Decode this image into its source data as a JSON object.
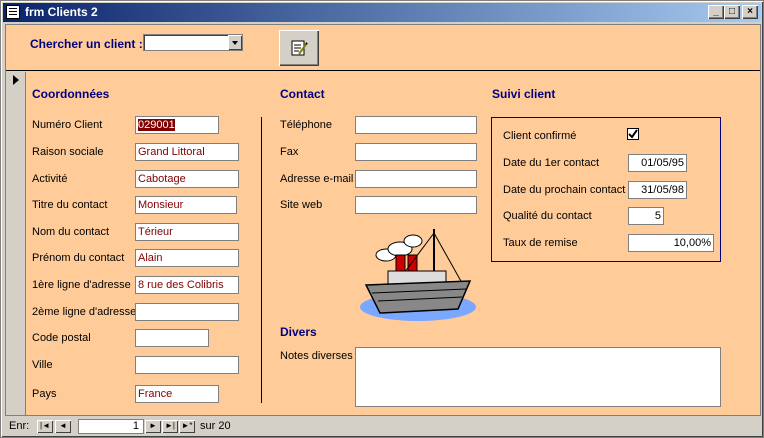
{
  "window": {
    "title": "frm Clients 2"
  },
  "titlebar_buttons": {
    "minimize": "_",
    "maximize": "□",
    "close": "×"
  },
  "header": {
    "search_label": "Chercher un client :",
    "search_value": "",
    "edit_icon": "notepad-pencil-icon"
  },
  "coordonnees": {
    "title": "Coordonnées",
    "fields": [
      {
        "label": "Numéro Client",
        "value": "029001"
      },
      {
        "label": "Raison sociale",
        "value": "Grand Littoral"
      },
      {
        "label": "Activité",
        "value": "Cabotage"
      },
      {
        "label": "Titre du contact",
        "value": "Monsieur"
      },
      {
        "label": "Nom du contact",
        "value": "Térieur"
      },
      {
        "label": "Prénom du contact",
        "value": "Alain"
      },
      {
        "label": "1ère ligne d'adresse",
        "value": "8 rue des Colibris"
      },
      {
        "label": "2ème ligne d'adresse",
        "value": ""
      },
      {
        "label": "Code postal",
        "value": ""
      },
      {
        "label": "Ville",
        "value": ""
      },
      {
        "label": "Pays",
        "value": "France"
      }
    ]
  },
  "contact": {
    "title": "Contact",
    "fields": [
      {
        "label": "Téléphone",
        "value": ""
      },
      {
        "label": "Fax",
        "value": ""
      },
      {
        "label": "Adresse e-mail",
        "value": ""
      },
      {
        "label": "Site web",
        "value": ""
      }
    ],
    "image_icon": "ship-clipart-icon"
  },
  "divers": {
    "title": "Divers",
    "notes_label": "Notes diverses",
    "notes_value": ""
  },
  "suivi": {
    "title": "Suivi client",
    "confirmed_label": "Client confirmé",
    "confirmed": true,
    "fields": [
      {
        "label": "Date du 1er contact",
        "value": "01/05/95"
      },
      {
        "label": "Date du prochain contact",
        "value": "31/05/98"
      },
      {
        "label": "Qualité du contact",
        "value": "5"
      },
      {
        "label": "Taux de remise",
        "value": "10,00%"
      }
    ]
  },
  "nav": {
    "label": "Enr:",
    "current": "1",
    "total_label": "sur 20",
    "first": "|◄",
    "prev": "◄",
    "next": "►",
    "last": "►|",
    "new": "►*"
  }
}
